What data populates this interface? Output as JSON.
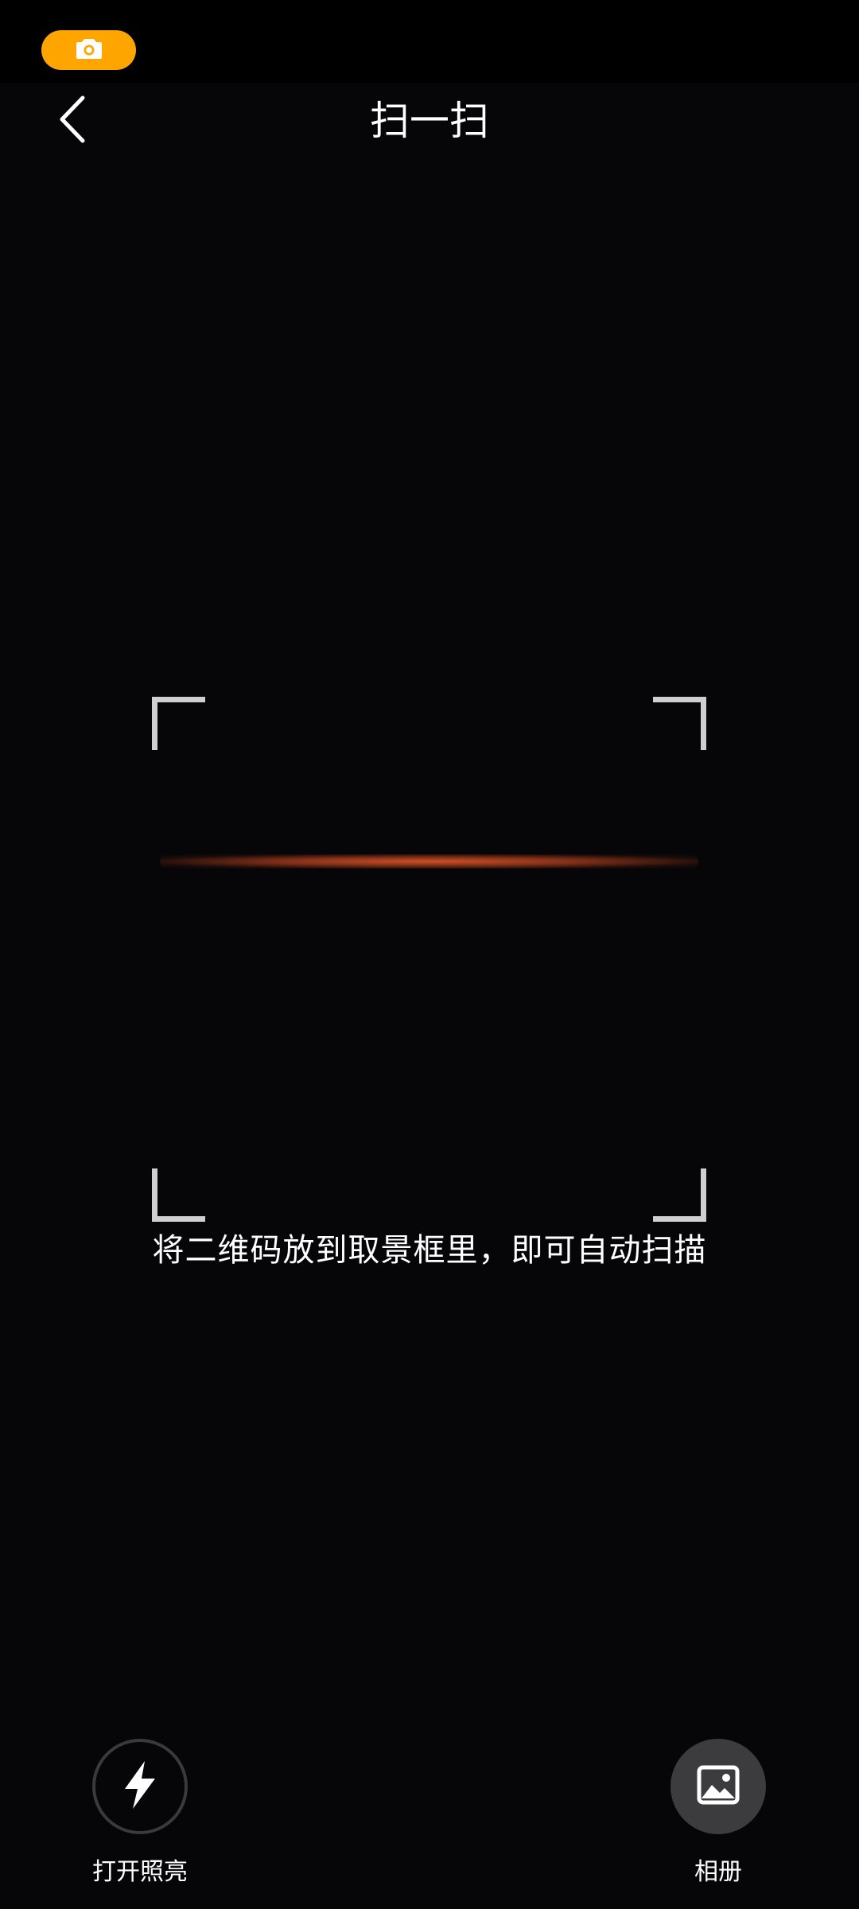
{
  "status_bar": {
    "camera_indicator_icon": "camera-icon",
    "indicator_color": "#ffa500"
  },
  "header": {
    "back_icon": "chevron-left-icon",
    "title": "扫一扫"
  },
  "scanner": {
    "scan_line_color": "#d65628",
    "corner_color": "#cfcfcf",
    "hint": "将二维码放到取景框里，即可自动扫描"
  },
  "bottom_actions": {
    "torch": {
      "icon": "flash-icon",
      "label": "打开照亮"
    },
    "album": {
      "icon": "image-icon",
      "label": "相册"
    }
  }
}
